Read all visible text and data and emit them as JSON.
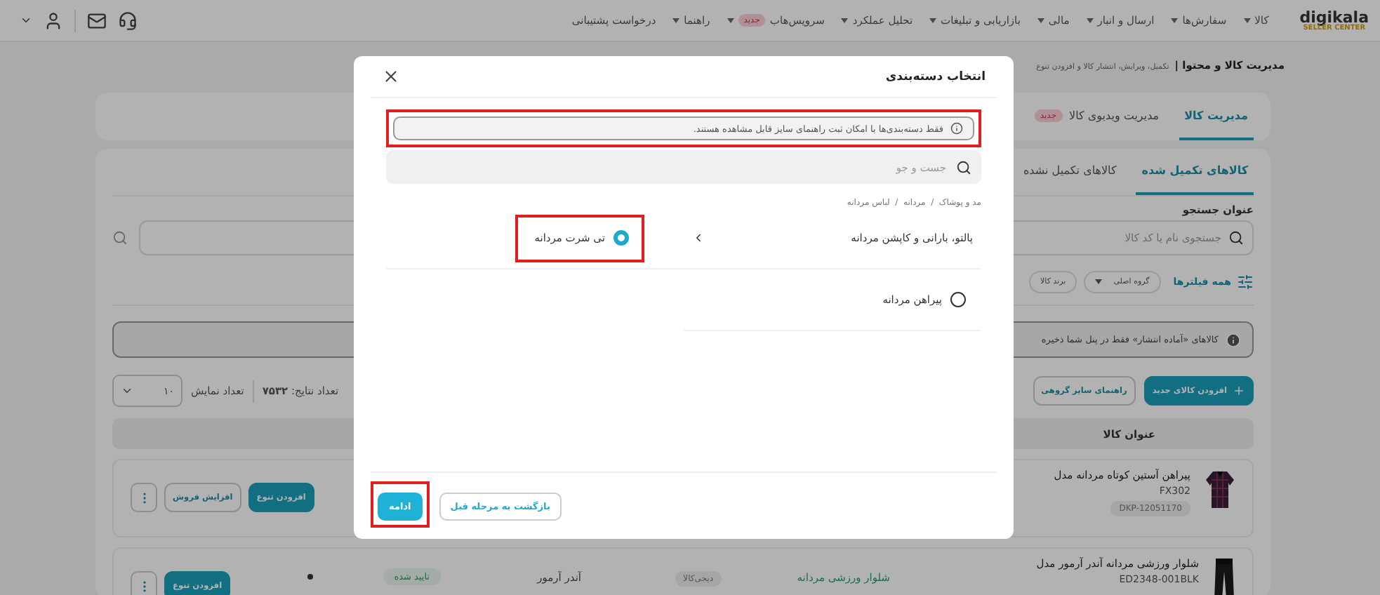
{
  "nav": {
    "logo": {
      "name": "digikala",
      "sub": "SELLER CENTER"
    },
    "menu": [
      {
        "label": "کالا",
        "dropdown": true
      },
      {
        "label": "سفارش‌ها",
        "dropdown": true
      },
      {
        "label": "ارسال و انبار",
        "dropdown": true
      },
      {
        "label": "مالی",
        "dropdown": true
      },
      {
        "label": "بازاریابی و تبلیغات",
        "dropdown": true
      },
      {
        "label": "تحلیل عملکرد",
        "dropdown": true
      },
      {
        "label": "سرویس‌هاب",
        "badge": "جدید",
        "dropdown": true
      },
      {
        "label": "راهنما",
        "dropdown": true
      },
      {
        "label": "درخواست پشتیبانی",
        "dropdown": false
      }
    ]
  },
  "breadcrumb": {
    "title": "مدیریت کالا و محتوا |",
    "subtitle": "تکمیل، ویرایش، انتشار کالا و افزودن تنوع"
  },
  "page_tabs": [
    {
      "label": "مدیریت کالا",
      "selected": true
    },
    {
      "label": "مدیریت ویدیوی کالا",
      "badge": "جدید",
      "selected": false
    }
  ],
  "content": {
    "tabs": [
      {
        "label": "کالاهای تکمیل شده",
        "selected": true
      },
      {
        "label": "کالاهای تکمیل نشده",
        "selected": false
      }
    ],
    "search_label": "عنوان جستجو",
    "search": {
      "placeholder": "جستجوی نام یا کد کالا"
    },
    "filters": {
      "all": "همه فیلترها",
      "items": [
        {
          "label": "گروه اصلی",
          "kind": "dropdown"
        },
        {
          "label": "برند کالا",
          "kind": "chip"
        }
      ]
    },
    "notice": "کالاهای «آماده انتشار» فقط در پنل شما ذخیره",
    "actions": [
      {
        "label": "افزودن کالای جدید",
        "kind": "primary"
      },
      {
        "label": "راهنمای سایز گروهی",
        "kind": "outline"
      }
    ],
    "results": "تعداد نتایج: **۷۵۳۲**",
    "page_size_label": "تعداد نمایش",
    "page_size": "۱۰",
    "table": {
      "columns": [
        "عنوان کالا"
      ],
      "rows": [
        {
          "title": "پیراهن آستین کوتاه مردانه مدل",
          "model": "FX302",
          "dkp": "DKP-12051170",
          "buttons": [
            {
              "label": "افزودن تنوع",
              "kind": "primary"
            },
            {
              "label": "افزایش فروش",
              "kind": "outline"
            }
          ]
        },
        {
          "title": "شلوار ورزشی مردانه آندر آرمور مدل",
          "model": "ED2348-001BLK",
          "category": "شلوار ورزشی مردانه",
          "seller": "دیجی‌کالا",
          "brand": "آندر آرمور",
          "status": "تایید شده",
          "buttons": [
            {
              "label": "افزودن تنوع",
              "kind": "primary"
            }
          ]
        }
      ]
    }
  },
  "modal": {
    "title": "انتخاب دسته‌بندی",
    "info": {
      "text": "فقط دسته‌بندی‌ها با امکان ثبت راهنمای سایز قابل مشاهده هستند.",
      "highlighted": true
    },
    "search": {
      "placeholder": "جست و جو"
    },
    "path": "مد و پوشاک  /  مردانه  /  لباس مردانه",
    "columns": [
      {
        "items": [
          {
            "label": "پالتو، بارانی و کاپشن مردانه",
            "kind": "parent",
            "expanded": true
          },
          {
            "label": "پیراهن مردانه",
            "kind": "radio",
            "selected": false,
            "highlighted": false
          }
        ]
      },
      {
        "items": [
          {
            "label": "تی شرت مردانه",
            "kind": "radio",
            "selected": true,
            "highlighted": true
          }
        ]
      }
    ],
    "buttons": [
      {
        "label": "بازگشت به مرحله قبل",
        "kind": "secondary",
        "highlighted": false
      },
      {
        "label": "ادامه",
        "kind": "primary",
        "highlighted": true
      }
    ]
  }
}
